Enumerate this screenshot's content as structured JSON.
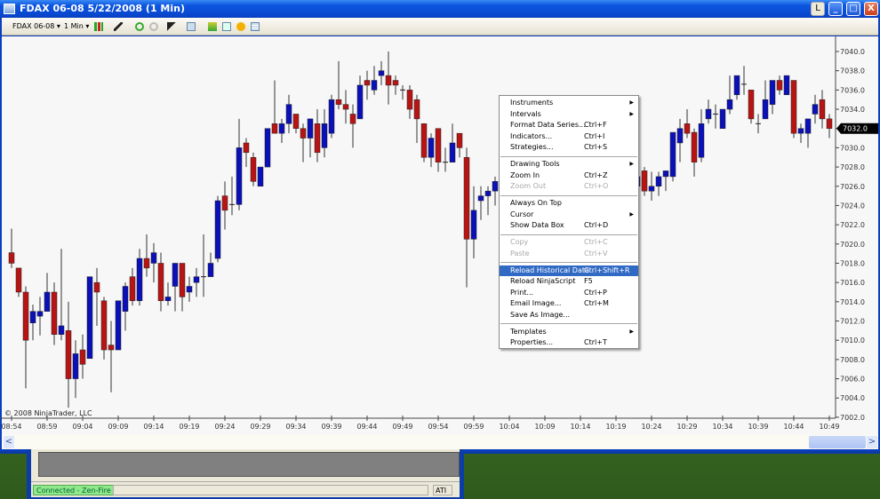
{
  "window": {
    "title": "FDAX 06-08  5/22/2008 (1 Min)",
    "l_button": "L",
    "minimize": "_",
    "maximize": "□",
    "close": "X"
  },
  "toolbar": {
    "instrument": "FDAX 06-08 ▾",
    "interval": "1 Min ▾"
  },
  "chart": {
    "copyright": "© 2008 NinjaTrader, LLC",
    "current_price_label": "7032.0",
    "colors": {
      "up": "#0b10b8",
      "down": "#b81414",
      "wick": "#333333"
    }
  },
  "chart_data": {
    "type": "candlestick",
    "instrument": "FDAX 06-08",
    "interval": "1 Min",
    "ylim": [
      7001,
      7041
    ],
    "y_ticks": [
      7040,
      7038,
      7036,
      7034,
      7032,
      7030,
      7028,
      7026,
      7024,
      7022,
      7020,
      7018,
      7016,
      7014,
      7012,
      7010,
      7008,
      7006,
      7004,
      7002
    ],
    "y_tick_labels": [
      "7040.0",
      "7038.0",
      "7036.0",
      "7034.0",
      "7032.0",
      "7030.0",
      "7028.0",
      "7026.0",
      "7024.0",
      "7022.0",
      "7020.0",
      "7018.0",
      "7016.0",
      "7014.0",
      "7012.0",
      "7010.0",
      "7008.0",
      "7006.0",
      "7004.0",
      "7002.0"
    ],
    "x_tick_labels": [
      "08:54",
      "08:59",
      "09:04",
      "09:09",
      "09:14",
      "09:19",
      "09:24",
      "09:29",
      "09:34",
      "09:39",
      "09:44",
      "09:49",
      "09:54",
      "09:59",
      "10:04",
      "10:09",
      "10:14",
      "10:19",
      "10:24",
      "10:29",
      "10:34",
      "10:39",
      "10:44",
      "10:49"
    ],
    "x_tick_every_bars": 5,
    "last_price": 7032.0,
    "ohlc": [
      [
        7019.1,
        7021.6,
        7017.5,
        7018.0
      ],
      [
        7017.5,
        7017.5,
        7014.5,
        7015.0
      ],
      [
        7015.0,
        7015.6,
        7005.0,
        7010.0
      ],
      [
        7011.8,
        7013.7,
        7010.0,
        7013.0
      ],
      [
        7012.5,
        7014.5,
        7010.5,
        7013.0
      ],
      [
        7013.0,
        7017.0,
        7013.0,
        7015.0
      ],
      [
        7015.0,
        7016.0,
        7009.5,
        7010.6
      ],
      [
        7010.6,
        7019.5,
        7010.0,
        7011.5
      ],
      [
        7011.0,
        7014.0,
        7003.0,
        7006.0
      ],
      [
        7006.0,
        7010.0,
        7004.0,
        7008.6
      ],
      [
        7009.0,
        7010.6,
        7006.0,
        7007.5
      ],
      [
        7008.1,
        7016.6,
        7008.1,
        7016.6
      ],
      [
        7016.0,
        7017.5,
        7011.5,
        7015.0
      ],
      [
        7014.1,
        7014.5,
        7008.0,
        7009.0
      ],
      [
        7009.5,
        7012.0,
        7004.6,
        7009.0
      ],
      [
        7009.0,
        7014.1,
        7009.0,
        7014.1
      ],
      [
        7013.0,
        7016.0,
        7011.0,
        7015.6
      ],
      [
        7016.6,
        7017.5,
        7013.6,
        7014.1
      ],
      [
        7014.1,
        7019.5,
        7013.6,
        7018.5
      ],
      [
        7018.5,
        7021.0,
        7016.6,
        7017.5
      ],
      [
        7018.0,
        7020.1,
        7016.0,
        7019.1
      ],
      [
        7018.0,
        7019.1,
        7013.0,
        7014.1
      ],
      [
        7014.1,
        7016.0,
        7013.6,
        7014.5
      ],
      [
        7015.6,
        7018.0,
        7013.0,
        7018.0
      ],
      [
        7018.0,
        7018.0,
        7013.0,
        7014.5
      ],
      [
        7015.0,
        7016.6,
        7014.0,
        7015.6
      ],
      [
        7016.0,
        7017.5,
        7014.5,
        7016.6
      ],
      [
        7016.6,
        7021.0,
        7014.5,
        7016.6
      ],
      [
        7016.6,
        7019.1,
        7016.6,
        7018.0
      ],
      [
        7018.5,
        7025.0,
        7018.1,
        7024.5
      ],
      [
        7025.0,
        7026.5,
        7021.5,
        7023.5
      ],
      [
        7024.1,
        7027.0,
        7023.0,
        7024.1
      ],
      [
        7024.1,
        7033.0,
        7023.5,
        7030.0
      ],
      [
        7030.5,
        7031.0,
        7028.0,
        7029.5
      ],
      [
        7029.0,
        7029.5,
        7026.0,
        7026.5
      ],
      [
        7026.0,
        7028.0,
        7026.0,
        7028.0
      ],
      [
        7028.0,
        7032.0,
        7028.0,
        7032.0
      ],
      [
        7032.5,
        7037.0,
        7031.5,
        7031.5
      ],
      [
        7031.5,
        7033.0,
        7030.5,
        7032.5
      ],
      [
        7032.5,
        7035.5,
        7031.5,
        7034.5
      ],
      [
        7033.5,
        7033.5,
        7031.5,
        7032.0
      ],
      [
        7032.0,
        7032.5,
        7028.5,
        7031.0
      ],
      [
        7031.0,
        7033.0,
        7029.0,
        7033.0
      ],
      [
        7032.5,
        7034.0,
        7028.5,
        7029.5
      ],
      [
        7030.0,
        7034.0,
        7029.0,
        7032.5
      ],
      [
        7031.5,
        7035.5,
        7031.0,
        7035.0
      ],
      [
        7035.0,
        7039.0,
        7034.0,
        7034.5
      ],
      [
        7034.5,
        7036.0,
        7032.5,
        7034.0
      ],
      [
        7033.5,
        7034.5,
        7030.0,
        7032.5
      ],
      [
        7033.0,
        7037.5,
        7033.0,
        7036.5
      ],
      [
        7037.0,
        7038.0,
        7035.0,
        7036.5
      ],
      [
        7036.0,
        7038.5,
        7035.5,
        7037.0
      ],
      [
        7037.5,
        7039.0,
        7036.5,
        7038.0
      ],
      [
        7037.5,
        7040.0,
        7034.5,
        7036.5
      ],
      [
        7037.0,
        7037.5,
        7035.5,
        7036.5
      ],
      [
        7036.0,
        7036.5,
        7035.0,
        7036.0
      ],
      [
        7036.0,
        7036.5,
        7033.0,
        7034.0
      ],
      [
        7035.0,
        7035.5,
        7030.5,
        7033.0
      ],
      [
        7032.5,
        7032.5,
        7028.5,
        7029.0
      ],
      [
        7029.0,
        7031.5,
        7028.0,
        7031.0
      ],
      [
        7032.0,
        7032.0,
        7027.5,
        7028.5
      ],
      [
        7028.5,
        7030.0,
        7027.5,
        7028.5
      ],
      [
        7028.5,
        7032.5,
        7028.5,
        7030.5
      ],
      [
        7031.5,
        7031.5,
        7029.0,
        7030.0
      ],
      [
        7029.0,
        7030.0,
        7015.5,
        7020.5
      ],
      [
        7020.5,
        7026.0,
        7018.5,
        7023.5
      ],
      [
        7024.5,
        7026.0,
        7022.5,
        7025.0
      ],
      [
        7025.0,
        7026.0,
        7023.0,
        7025.5
      ],
      [
        7025.5,
        7027.0,
        7024.0,
        7026.5
      ],
      null,
      null,
      null,
      null,
      null,
      null,
      null,
      null,
      null,
      null,
      null,
      null,
      null,
      null,
      null,
      null,
      null,
      null,
      null,
      [
        7026.0,
        7027.5,
        7025.5,
        7027.0
      ],
      [
        7027.6,
        7028.0,
        7025.0,
        7025.5
      ],
      [
        7025.5,
        7027.5,
        7024.5,
        7026.0
      ],
      [
        7026.0,
        7027.5,
        7025.0,
        7027.0
      ],
      [
        7027.0,
        7027.6,
        7025.5,
        7027.6
      ],
      [
        7027.0,
        7031.6,
        7026.5,
        7031.6
      ],
      [
        7030.5,
        7033.0,
        7028.5,
        7032.0
      ],
      [
        7032.5,
        7034.0,
        7031.0,
        7031.5
      ],
      [
        7031.6,
        7032.0,
        7027.0,
        7028.5
      ],
      [
        7029.0,
        7034.0,
        7028.5,
        7032.5
      ],
      [
        7033.0,
        7035.0,
        7032.5,
        7034.0
      ],
      [
        7033.5,
        7034.5,
        7032.0,
        7033.5
      ],
      [
        7032.0,
        7034.0,
        7032.0,
        7034.0
      ],
      [
        7034.0,
        7037.5,
        7033.5,
        7035.0
      ],
      [
        7035.5,
        7037.5,
        7035.0,
        7037.5
      ],
      [
        7036.6,
        7038.5,
        7035.5,
        7036.6
      ],
      [
        7036.0,
        7036.0,
        7032.5,
        7033.0
      ],
      [
        7032.5,
        7033.5,
        7031.5,
        7032.5
      ],
      [
        7033.0,
        7037.0,
        7033.0,
        7035.0
      ],
      [
        7034.5,
        7037.0,
        7033.5,
        7037.0
      ],
      [
        7037.0,
        7037.5,
        7035.5,
        7036.0
      ],
      [
        7035.5,
        7037.5,
        7035.5,
        7037.5
      ],
      [
        7037.0,
        7037.0,
        7031.0,
        7031.5
      ],
      [
        7031.5,
        7032.5,
        7030.5,
        7032.0
      ],
      [
        7031.5,
        7033.0,
        7030.0,
        7033.0
      ],
      [
        7033.5,
        7035.5,
        7032.5,
        7034.5
      ],
      [
        7035.0,
        7036.0,
        7032.0,
        7033.0
      ],
      [
        7033.0,
        7033.5,
        7031.0,
        7032.0
      ]
    ]
  },
  "context_menu": {
    "groups": [
      [
        {
          "label": "Instruments",
          "shortcut": "",
          "submenu": true
        },
        {
          "label": "Intervals",
          "shortcut": "",
          "submenu": true
        },
        {
          "label": "Format Data Series...",
          "shortcut": "Ctrl+F"
        },
        {
          "label": "Indicators...",
          "shortcut": "Ctrl+I"
        },
        {
          "label": "Strategies...",
          "shortcut": "Ctrl+S"
        }
      ],
      [
        {
          "label": "Drawing Tools",
          "shortcut": "",
          "submenu": true
        },
        {
          "label": "Zoom In",
          "shortcut": "Ctrl+Z"
        },
        {
          "label": "Zoom Out",
          "shortcut": "Ctrl+O",
          "disabled": true
        }
      ],
      [
        {
          "label": "Always On Top",
          "shortcut": ""
        },
        {
          "label": "Cursor",
          "shortcut": "",
          "submenu": true
        },
        {
          "label": "Show Data Box",
          "shortcut": "Ctrl+D"
        }
      ],
      [
        {
          "label": "Copy",
          "shortcut": "Ctrl+C",
          "disabled": true
        },
        {
          "label": "Paste",
          "shortcut": "Ctrl+V",
          "disabled": true
        }
      ],
      [
        {
          "label": "Reload Historical Data",
          "shortcut": "Ctrl+Shift+R",
          "highlighted": true
        },
        {
          "label": "Reload NinjaScript",
          "shortcut": "F5"
        },
        {
          "label": "Print...",
          "shortcut": "Ctrl+P"
        },
        {
          "label": "Email Image...",
          "shortcut": "Ctrl+M"
        },
        {
          "label": "Save As Image...",
          "shortcut": ""
        }
      ],
      [
        {
          "label": "Templates",
          "shortcut": "",
          "submenu": true
        },
        {
          "label": "Properties...",
          "shortcut": "Ctrl+T"
        }
      ]
    ]
  },
  "scrollbar": {
    "left": "<",
    "right": ">"
  },
  "status_bar": {
    "connection": "Connected - Zen-Fire",
    "provider": "ATI"
  }
}
